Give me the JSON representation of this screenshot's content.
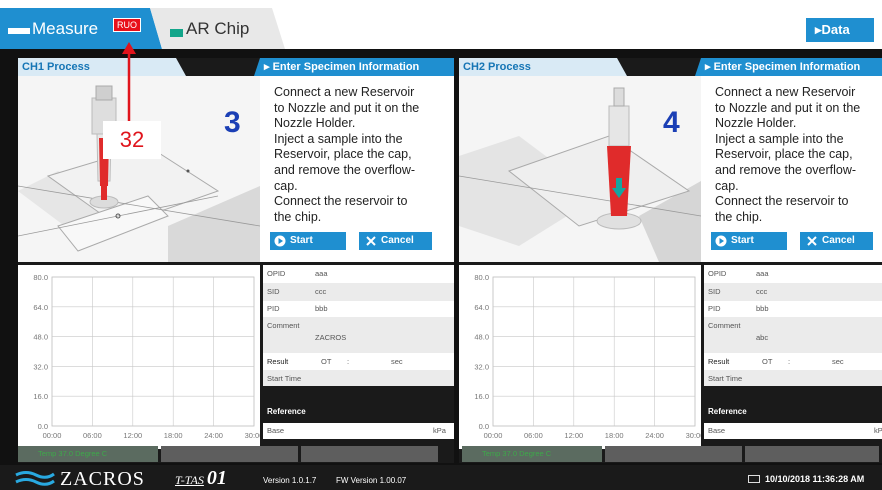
{
  "tabs": {
    "measure_label": "Measure",
    "ruo_badge": "RUO",
    "ar_chip_label": "AR Chip",
    "data_button_label": "Data",
    "data_button_arrow": "▸"
  },
  "annotation": {
    "label": "32",
    "color": "#e0141c"
  },
  "channels": [
    {
      "title": "CH1 Process",
      "spec_header": "Enter  Specimen Information",
      "step_number": "3",
      "instructions": "Connect a new Reservoir\nto Nozzle and put it on the\nNozzle Holder.\nInject a sample into the\nReservoir, place the cap,\nand remove the overflow-\ncap.\nConnect the reservoir to\nthe chip.",
      "start_label": "Start",
      "cancel_label": "Cancel",
      "fields": {
        "opid_label": "OPID",
        "opid_value": "aaa",
        "sid_label": "SID",
        "sid_value": "ccc",
        "pid_label": "PID",
        "pid_value": "bbb",
        "comment_label": "Comment",
        "comment_value": "ZACROS",
        "result_label": "Result",
        "result_ot": "OT",
        "result_colon": ":",
        "result_unit": "sec",
        "start_time_label": "Start Time",
        "reference_label": "Reference",
        "base_label": "Base",
        "base_unit": "kPa"
      },
      "status_temp": "Temp 37.0 Degree C"
    },
    {
      "title": "CH2 Process",
      "spec_header": "Enter  Specimen Information",
      "step_number": "4",
      "instructions": "Connect a new Reservoir\nto Nozzle and put it on the\nNozzle Holder.\nInject a sample into the\nReservoir, place the cap,\nand remove the overflow-\ncap.\nConnect the reservoir to\nthe chip.",
      "start_label": "Start",
      "cancel_label": "Cancel",
      "fields": {
        "opid_label": "OPID",
        "opid_value": "aaa",
        "sid_label": "SID",
        "sid_value": "ccc",
        "pid_label": "PID",
        "pid_value": "bbb",
        "comment_label": "Comment",
        "comment_value": "abc",
        "result_label": "Result",
        "result_ot": "OT",
        "result_colon": ":",
        "result_unit": "sec",
        "start_time_label": "Start Time",
        "reference_label": "Reference",
        "base_label": "Base",
        "base_unit": "kPa"
      },
      "status_temp": "Temp 37.0 Degree C"
    }
  ],
  "chart_data": [
    {
      "type": "line",
      "x_ticks": [
        "00:00",
        "06:00",
        "12:00",
        "18:00",
        "24:00",
        "30:00"
      ],
      "y_ticks": [
        "80.0",
        "64.0",
        "48.0",
        "32.0",
        "16.0",
        "0.0"
      ],
      "ylim": [
        0,
        80
      ],
      "grid": true,
      "series": []
    },
    {
      "type": "line",
      "x_ticks": [
        "00:00",
        "06:00",
        "12:00",
        "18:00",
        "24:00",
        "30:00"
      ],
      "y_ticks": [
        "80.0",
        "64.0",
        "48.0",
        "32.0",
        "16.0",
        "0.0"
      ],
      "ylim": [
        0,
        80
      ],
      "grid": true,
      "series": []
    }
  ],
  "footer": {
    "company": "ZACROS",
    "product_prefix": "T-TAS",
    "product_suffix": "01",
    "version": "Version 1.0.1.7",
    "fw_version": "FW Version 1.00.07",
    "datetime": "10/10/2018 11:36:28 AM"
  },
  "colors": {
    "accent_blue": "#1f8fd0",
    "ruo_red": "#e8101a",
    "chip_green": "#12a58a",
    "step_number": "#1b3fb5",
    "temp_green": "#3ea84a"
  }
}
